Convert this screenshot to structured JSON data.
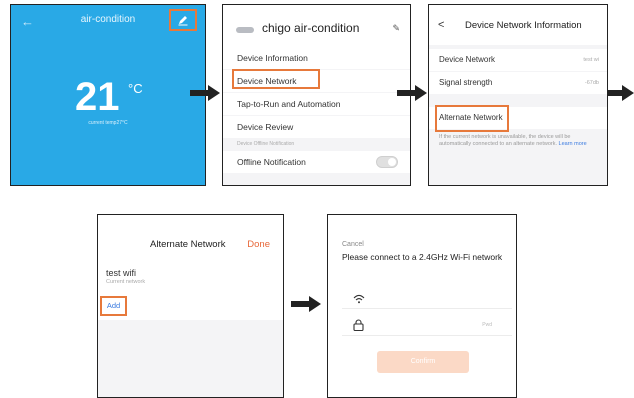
{
  "screen1": {
    "back_icon": "arrow-left-icon",
    "title": "air-condition",
    "edit_icon": "pencil-icon",
    "temperature": "21",
    "unit": "°C",
    "subtitle": "current temp27°C"
  },
  "screen2": {
    "device_name": "chigo air-condition",
    "items": [
      "Device Information",
      "Device Network",
      "Tap-to-Run and Automation",
      "Device Review"
    ],
    "section_label": "Device Offline Notification",
    "offline_label": "Offline Notification",
    "toggle_state": "off"
  },
  "screen3": {
    "title": "Device Network Information",
    "network_label": "Device Network",
    "network_value": "test wi",
    "signal_label": "Signal strength",
    "signal_value": "-67db",
    "alternate_label": "Alternate Network",
    "note": "If the current network is unavailable, the device will be automatically connected to an alternate network.",
    "learn_more": "Learn more"
  },
  "screen4": {
    "title": "Alternate Network",
    "done": "Done",
    "wifi_name": "test wifi",
    "current_label": "Current network",
    "add": "Add"
  },
  "screen5": {
    "cancel": "Cancel",
    "title": "Please connect to a 2.4GHz Wi-Fi network",
    "password_hint": "Pwd",
    "confirm": "Confirm"
  },
  "colors": {
    "primary_blue": "#29a9e6",
    "highlight_orange": "#e7793b",
    "done_orange": "#e8683a",
    "link_blue": "#3b7be0",
    "confirm_bg": "#fbd9c6"
  }
}
